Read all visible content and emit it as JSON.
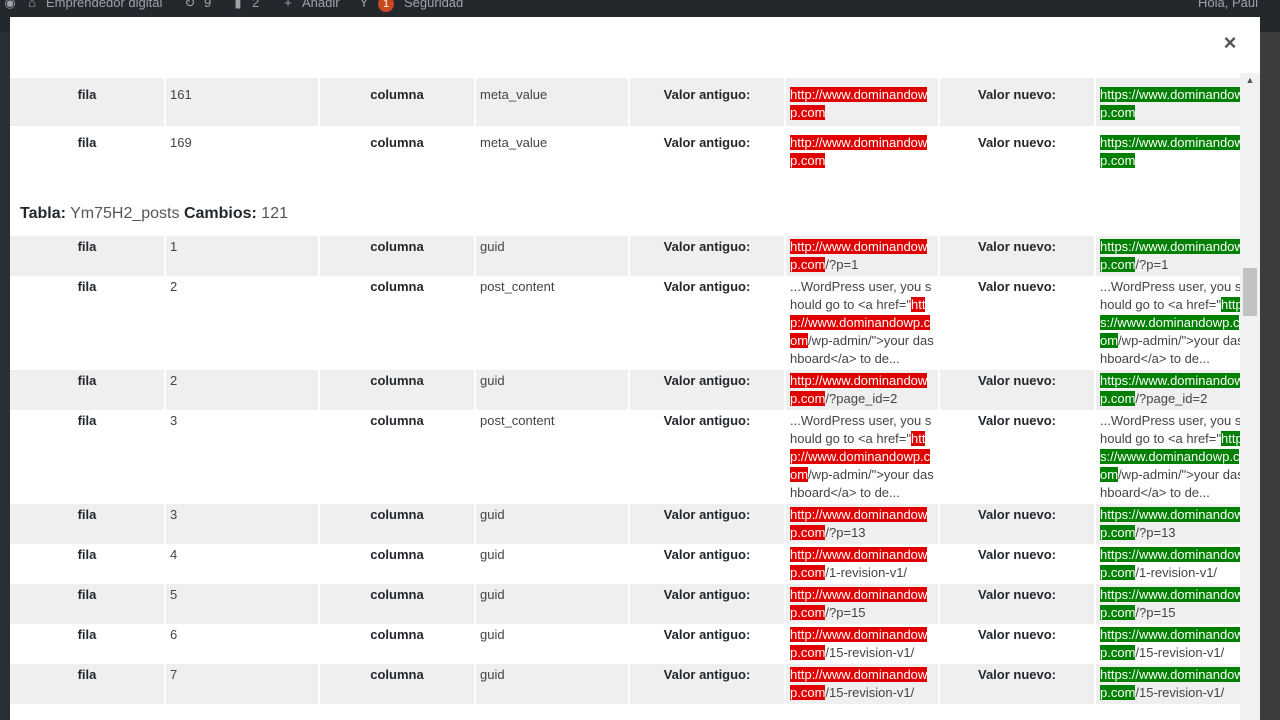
{
  "adminbar": {
    "site_name": "Emprendedor digital",
    "updates_count": "9",
    "comments_count": "2",
    "add_label": "Añadir",
    "yoast_badge": "1",
    "security_label": "Seguridad",
    "greeting": "Hola, Paul"
  },
  "modal": {
    "close_symbol": "×"
  },
  "labels": {
    "fila": "fila",
    "columna": "columna",
    "old": "Valor antiguo:",
    "new": "Valor nuevo:"
  },
  "table1_rows": [
    {
      "id": "161",
      "column": "meta_value",
      "old_hl": "http://www.dominandowp.com",
      "old_rest": "",
      "new_hl": "https://www.dominandowp.com",
      "new_rest": ""
    },
    {
      "id": "169",
      "column": "meta_value",
      "old_hl": "http://www.dominandowp.com",
      "old_rest": "",
      "new_hl": "https://www.dominandowp.com",
      "new_rest": ""
    }
  ],
  "table2": {
    "tabla_label": "Tabla:",
    "tabla_name": "Ym75H2_posts",
    "cambios_label": "Cambios:",
    "cambios_count": "121"
  },
  "table2_rows": [
    {
      "id": "1",
      "column": "guid",
      "old_pre": "",
      "old_hl": "http://www.dominandowp.com",
      "old_rest": "/?p=1",
      "new_pre": "",
      "new_hl": "https://www.dominandowp.com",
      "new_rest": "/?p=1"
    },
    {
      "id": "2",
      "column": "post_content",
      "old_pre": "...WordPress user, you should go to <a href=\"",
      "old_hl": "http://www.dominandowp.com",
      "old_rest": "/wp-admin/\">your dashboard</a> to de...",
      "new_pre": "...WordPress user, you should go to <a href=\"",
      "new_hl": "https://www.dominandowp.com",
      "new_rest": "/wp-admin/\">your dashboard</a> to de..."
    },
    {
      "id": "2",
      "column": "guid",
      "old_pre": "",
      "old_hl": "http://www.dominandowp.com",
      "old_rest": "/?page_id=2",
      "new_pre": "",
      "new_hl": "https://www.dominandowp.com",
      "new_rest": "/?page_id=2"
    },
    {
      "id": "3",
      "column": "post_content",
      "old_pre": "...WordPress user, you should go to <a href=\"",
      "old_hl": "http://www.dominandowp.com",
      "old_rest": "/wp-admin/\">your dashboard</a> to de...",
      "new_pre": "...WordPress user, you should go to <a href=\"",
      "new_hl": "https://www.dominandowp.com",
      "new_rest": "/wp-admin/\">your dashboard</a> to de..."
    },
    {
      "id": "3",
      "column": "guid",
      "old_pre": "",
      "old_hl": "http://www.dominandowp.com",
      "old_rest": "/?p=13",
      "new_pre": "",
      "new_hl": "https://www.dominandowp.com",
      "new_rest": "/?p=13"
    },
    {
      "id": "4",
      "column": "guid",
      "old_pre": "",
      "old_hl": "http://www.dominandowp.com",
      "old_rest": "/1-revision-v1/",
      "new_pre": "",
      "new_hl": "https://www.dominandowp.com",
      "new_rest": "/1-revision-v1/"
    },
    {
      "id": "5",
      "column": "guid",
      "old_pre": "",
      "old_hl": "http://www.dominandowp.com",
      "old_rest": "/?p=15",
      "new_pre": "",
      "new_hl": "https://www.dominandowp.com",
      "new_rest": "/?p=15"
    },
    {
      "id": "6",
      "column": "guid",
      "old_pre": "",
      "old_hl": "http://www.dominandowp.com",
      "old_rest": "/15-revision-v1/",
      "new_pre": "",
      "new_hl": "https://www.dominandowp.com",
      "new_rest": "/15-revision-v1/"
    },
    {
      "id": "7",
      "column": "guid",
      "old_pre": "",
      "old_hl": "http://www.dominandowp.com",
      "old_rest": "/15-revision-v1/",
      "new_pre": "",
      "new_hl": "https://www.dominandowp.com",
      "new_rest": "/15-revision-v1/"
    }
  ],
  "colors": {
    "old_highlight": "#e00000",
    "new_highlight": "#008000",
    "stripe": "#efefef"
  }
}
